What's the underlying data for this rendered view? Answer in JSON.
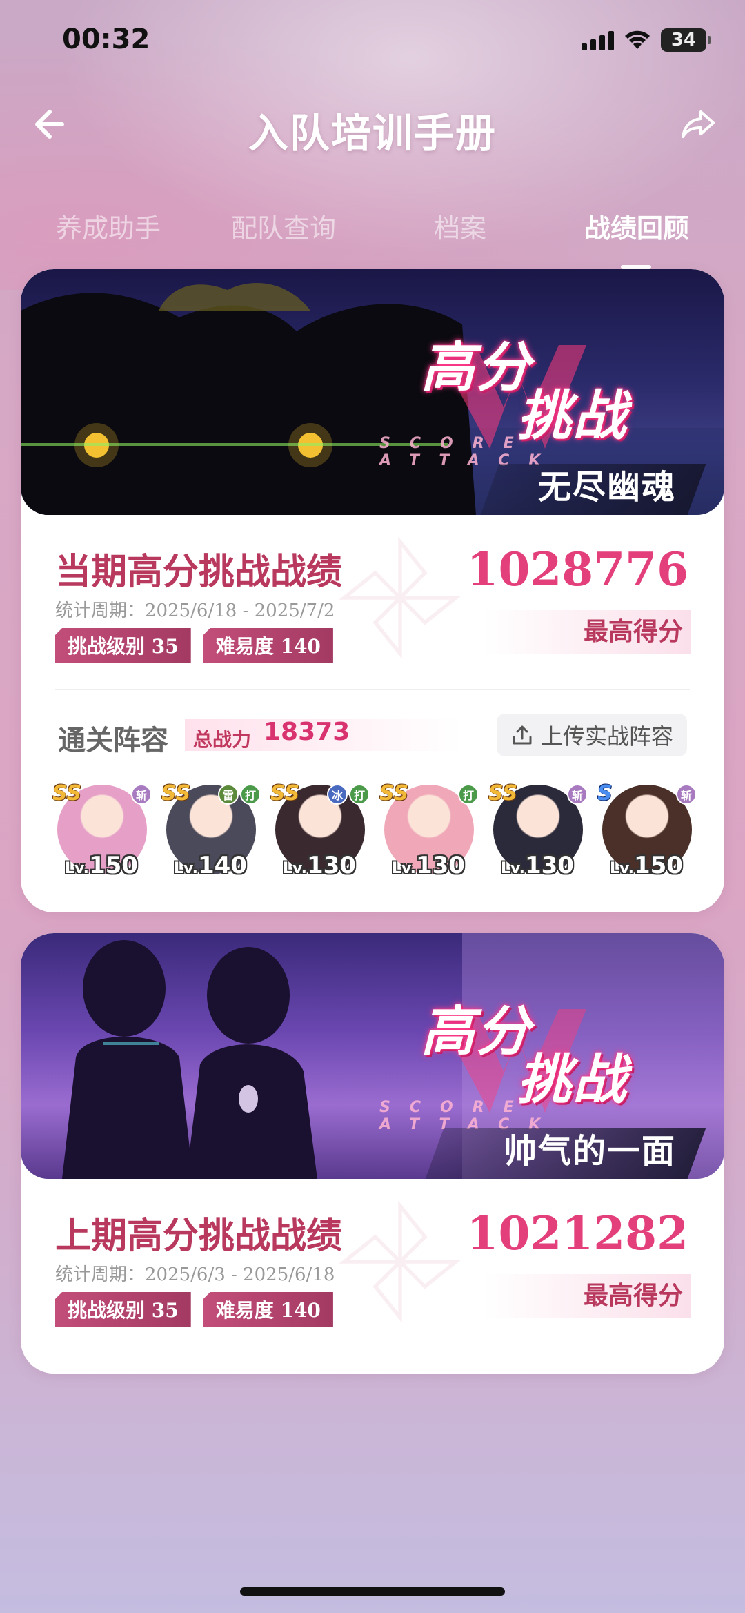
{
  "status": {
    "time": "00:32",
    "battery": "34"
  },
  "header": {
    "title": "入队培训手册"
  },
  "tabs": [
    {
      "label": "养成助手",
      "active": false
    },
    {
      "label": "配队查询",
      "active": false
    },
    {
      "label": "档案",
      "active": false
    },
    {
      "label": "战绩回顾",
      "active": true
    }
  ],
  "current": {
    "banner_title_1": "高分",
    "banner_title_2": "挑战",
    "banner_sub": "SCORE ATTACK",
    "banner_name": "无尽幽魂",
    "title": "当期高分挑战战绩",
    "period": "统计周期：2025/6/18 - 2025/7/2",
    "badge_level": "挑战级别 35",
    "badge_difficulty": "难易度 140",
    "score": "1028776",
    "score_label": "最高得分",
    "lineup_title": "通关阵容",
    "power_label": "总战力",
    "power_value": "18373",
    "upload_label": "上传实战阵容",
    "heroes": [
      {
        "rank": "SS",
        "tags": [
          "斩"
        ],
        "level_prefix": "Lv.",
        "level": "150",
        "color": "#e6a0c8"
      },
      {
        "rank": "SS",
        "tags": [
          "雷",
          "打"
        ],
        "level_prefix": "Lv.",
        "level": "140",
        "color": "#4a4a5a"
      },
      {
        "rank": "SS",
        "tags": [
          "冰",
          "打"
        ],
        "level_prefix": "Lv.",
        "level": "130",
        "color": "#3a2a30"
      },
      {
        "rank": "SS",
        "tags": [
          "打"
        ],
        "level_prefix": "Lv.",
        "level": "130",
        "color": "#f0a8b8"
      },
      {
        "rank": "SS",
        "tags": [
          "斩"
        ],
        "level_prefix": "Lv.",
        "level": "130",
        "color": "#2a2a3a"
      },
      {
        "rank": "S",
        "tags": [
          "斩"
        ],
        "level_prefix": "Lv.",
        "level": "150",
        "color": "#4a3028"
      }
    ]
  },
  "previous": {
    "banner_title_1": "高分",
    "banner_title_2": "挑战",
    "banner_sub": "SCORE ATTACK",
    "banner_name": "帅气的一面",
    "title": "上期高分挑战战绩",
    "period": "统计周期：2025/6/3 - 2025/6/18",
    "badge_level": "挑战级别 35",
    "badge_difficulty": "难易度 140",
    "score": "1021282",
    "score_label": "最高得分"
  },
  "tag_colors": {
    "斩": "#a87abf",
    "雷": "#5a8a3a",
    "打": "#4a9a4a",
    "冰": "#4a6ac0"
  },
  "accent": "#e23f7b"
}
